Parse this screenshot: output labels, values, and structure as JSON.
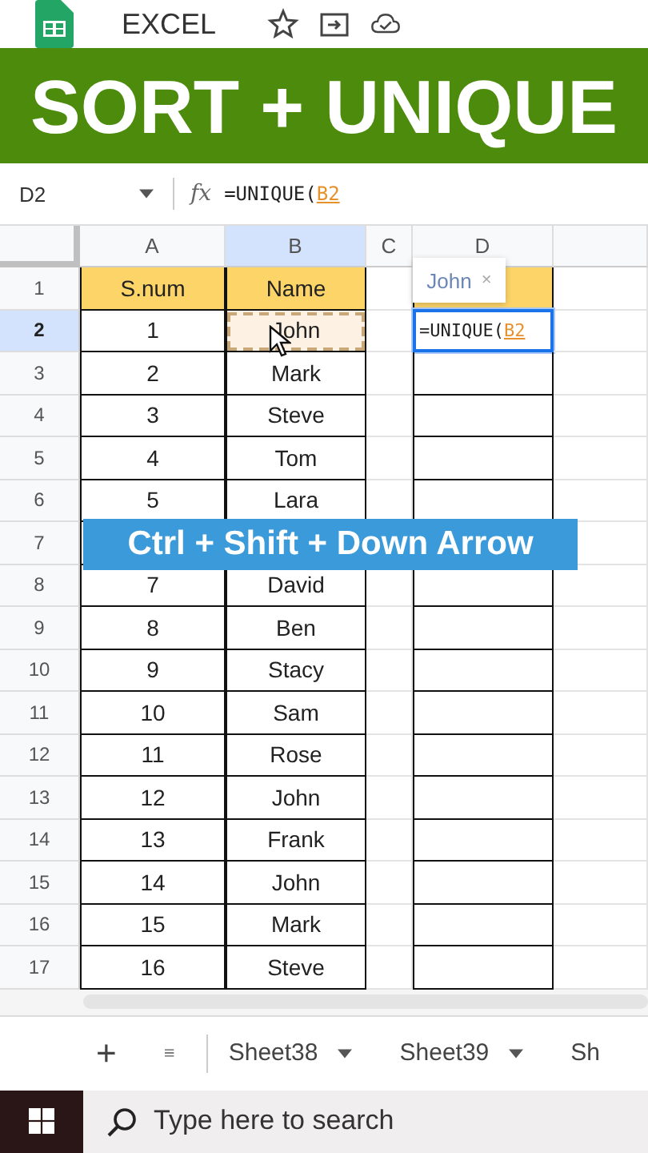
{
  "app": {
    "title": "EXCEL"
  },
  "banner": {
    "text": "SORT + UNIQUE"
  },
  "formula_bar": {
    "cell": "D2",
    "fx_label": "fx",
    "formula": "=UNIQUE(",
    "reference": "B2"
  },
  "columns": [
    {
      "label": "A",
      "selected": false
    },
    {
      "label": "B",
      "selected": true
    },
    {
      "label": "C",
      "selected": false
    },
    {
      "label": "D",
      "selected": false
    }
  ],
  "rows": [
    {
      "label": "1",
      "selected": false,
      "kind": "header",
      "a": "S.num",
      "b": "Name",
      "copied": false
    },
    {
      "label": "2",
      "selected": true,
      "kind": "data",
      "a": "1",
      "b": "John",
      "copied": true,
      "d": {
        "formula": "=UNIQUE(",
        "reference": "B2"
      }
    },
    {
      "label": "3",
      "selected": false,
      "kind": "data",
      "a": "2",
      "b": "Mark",
      "copied": false
    },
    {
      "label": "4",
      "selected": false,
      "kind": "data",
      "a": "3",
      "b": "Steve",
      "copied": false
    },
    {
      "label": "5",
      "selected": false,
      "kind": "data",
      "a": "4",
      "b": "Tom",
      "copied": false
    },
    {
      "label": "6",
      "selected": false,
      "kind": "data",
      "a": "5",
      "b": "Lara",
      "copied": false
    },
    {
      "label": "7",
      "selected": false,
      "kind": "data"
    },
    {
      "label": "8",
      "selected": false,
      "kind": "data",
      "a": "7",
      "b": "David",
      "copied": false
    },
    {
      "label": "9",
      "selected": false,
      "kind": "data",
      "a": "8",
      "b": "Ben",
      "copied": false
    },
    {
      "label": "10",
      "selected": false,
      "kind": "data",
      "a": "9",
      "b": "Stacy",
      "copied": false
    },
    {
      "label": "11",
      "selected": false,
      "kind": "data",
      "a": "10",
      "b": "Sam",
      "copied": false
    },
    {
      "label": "12",
      "selected": false,
      "kind": "data",
      "a": "11",
      "b": "Rose",
      "copied": false
    },
    {
      "label": "13",
      "selected": false,
      "kind": "data",
      "a": "12",
      "b": "John",
      "copied": false
    },
    {
      "label": "14",
      "selected": false,
      "kind": "data",
      "a": "13",
      "b": "Frank",
      "copied": false
    },
    {
      "label": "15",
      "selected": false,
      "kind": "data",
      "a": "14",
      "b": "John",
      "copied": false
    },
    {
      "label": "16",
      "selected": false,
      "kind": "data",
      "a": "15",
      "b": "Mark",
      "copied": false
    },
    {
      "label": "17",
      "selected": false,
      "kind": "data",
      "a": "16",
      "b": "Steve",
      "copied": false
    }
  ],
  "suggestion": {
    "text": "John",
    "close": "×"
  },
  "caption": {
    "text": "Ctrl + Shift + Down Arrow"
  },
  "sheet_bar": {
    "add": "+",
    "tabs": [
      {
        "label": "Sheet38",
        "selected": false
      },
      {
        "label": "Sheet39",
        "selected": false
      },
      {
        "label": "Sh",
        "selected": false
      }
    ]
  },
  "taskbar": {
    "search": {
      "placeholder": "Type here to search"
    }
  }
}
